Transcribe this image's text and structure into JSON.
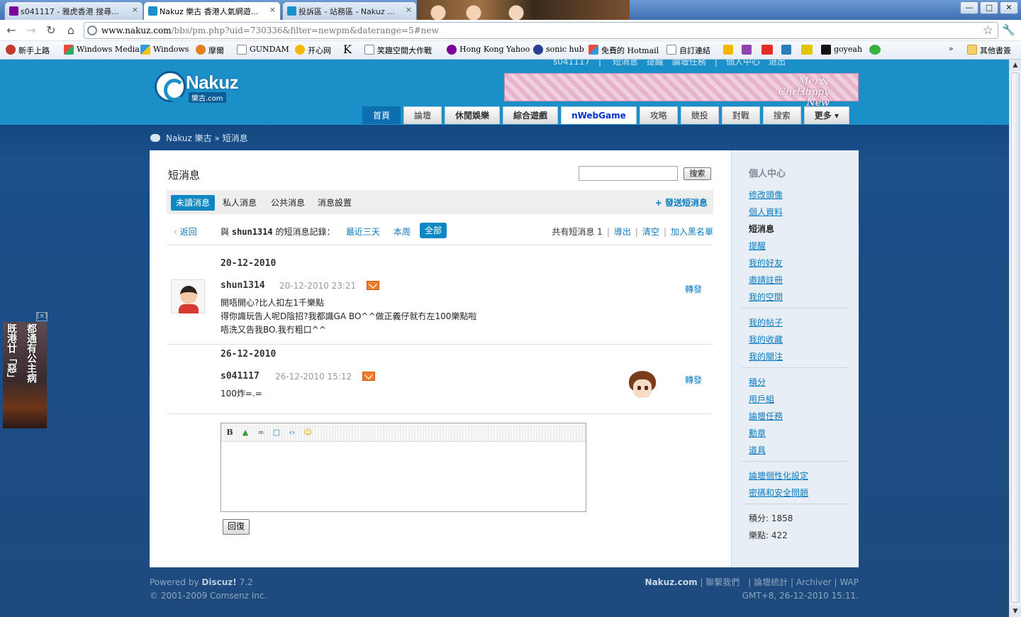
{
  "browser": {
    "tabs": [
      {
        "title": "s041117 - 雅虎香港 搜尋...",
        "icon": "yahoo-icon",
        "color": "#7b0099"
      },
      {
        "title": "Nakuz 樂古 香港人氣網遊...",
        "icon": "nakuz-icon",
        "color": "#1b8fc8"
      },
      {
        "title": "投訴區 - 站務區 - Nakuz ...",
        "icon": "nakuz-icon",
        "color": "#1b8fc8"
      }
    ],
    "tab_close": "×",
    "window_buttons": [
      "—",
      "□",
      "✕"
    ],
    "url_host": "www.nakuz.com",
    "url_path": "/bbs/pm.php?uid=730336&filter=newpm&daterange=5#new",
    "bookmarks": [
      "新手上路",
      "Windows Media",
      "Windows",
      "摩爾",
      "GUNDAM",
      "开心网",
      "K",
      "笑趣空間大作戰",
      "Hong Kong Yahoo",
      "sonic hub",
      "免費的 Hotmail",
      "自訂連結",
      "goyeah"
    ],
    "other_bookmarks": "其他書簽"
  },
  "header": {
    "top_links": "s041117　|　 短消息　提醒　論壇任務　|　個人中心　退出",
    "logo_text": "Nakuz",
    "logo_sub": "樂古.com",
    "banner_text": [
      "Merry Christmas",
      "& Happy New year"
    ],
    "nav": [
      "首頁",
      "論壇",
      "休閒娛樂",
      "綜合遊戲",
      "nWebGame",
      "攻略",
      "競投",
      "對戰",
      "搜索",
      "更多 ▾"
    ]
  },
  "breadcrumb": "Nakuz 樂古 » 短消息",
  "main": {
    "title": "短消息",
    "search_button": "搜索",
    "tabs": [
      "未讀消息",
      "私人消息",
      "公共消息",
      "消息設置"
    ],
    "send_link": "+ 發送短消息",
    "back": "返回",
    "filter_label_pre": "與",
    "filter_user": "shun1314",
    "filter_label_post": "的短消息記錄：",
    "filters": [
      "最近三天",
      "本周",
      "全部"
    ],
    "count_label": "共有短消息 1",
    "actions": [
      "導出",
      "清空",
      "加入黑名單"
    ],
    "messages": [
      {
        "date": "20-12-2010",
        "author": "shun1314",
        "time": "20-12-2010 23:21",
        "forward": "轉發",
        "lines": [
          "開唔開心?比人扣左1千樂點",
          "得你識玩告人呢D陰招?我都識GA BO^^做正義仔就冇左100樂點啦",
          "唔洗又告我BO.我冇粗口^^"
        ]
      },
      {
        "date": "26-12-2010",
        "author": "s041117",
        "time": "26-12-2010 15:12",
        "forward": "轉發",
        "lines": [
          "100炸=.="
        ]
      }
    ],
    "editor_tools": [
      "B",
      "▲",
      "∞",
      "▢",
      "‹›",
      "☺"
    ],
    "reply_button": "回復"
  },
  "sidebar": {
    "title": "個人中心",
    "group1": [
      "修改頭像",
      "個人資料",
      "短消息",
      "提醒",
      "我的好友",
      "邀請註冊",
      "我的空間"
    ],
    "group2": [
      "我的帖子",
      "我的收藏",
      "我的關注"
    ],
    "group3": [
      "積分",
      "用戶組",
      "論壇任務",
      "勳章",
      "道具"
    ],
    "group4": [
      "論壇個性化設定",
      "密碼和安全問題"
    ],
    "stats": [
      "積分: 1858",
      "樂點: 422"
    ]
  },
  "footer": {
    "powered_pre": "Powered by",
    "powered_brand": "Discuz!",
    "powered_ver": "7.2",
    "copyright": "© 2001-2009 Comsenz Inc.",
    "site": "Nakuz.com",
    "links": "| 聯繫我們　| 論壇統計 | Archiver | WAP",
    "time": "GMT+8, 26-12-2010 15:11."
  },
  "side_ad": {
    "close": "[×]",
    "lines": [
      "都通有公主病",
      "既港廿「惡」"
    ]
  }
}
